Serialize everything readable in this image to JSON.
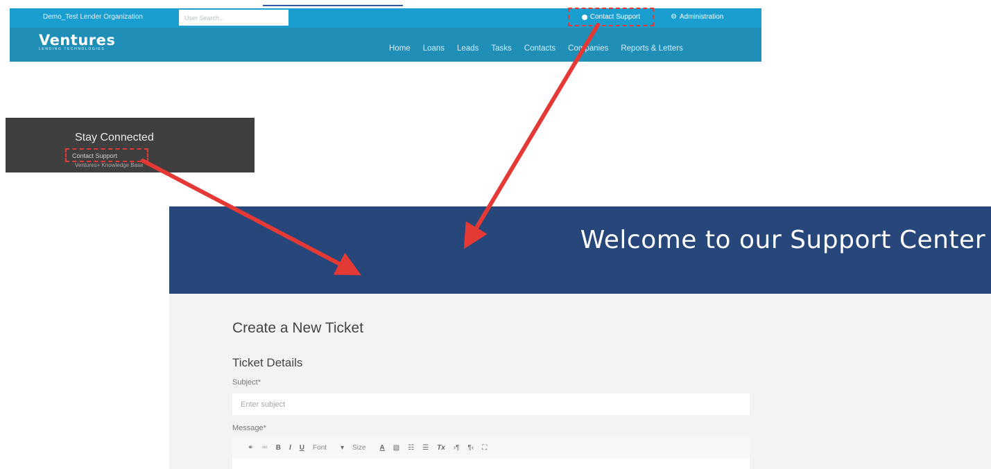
{
  "app_header": {
    "org_name": "Demo_Test Lender Organization",
    "search_placeholder": "User Search...",
    "contact_support": "Contact Support",
    "administration": "Administration",
    "logo_word": "Ventures",
    "logo_sub": "LENDING TECHNOLOGIES",
    "nav": [
      "Home",
      "Loans",
      "Leads",
      "Tasks",
      "Contacts",
      "Companies",
      "Reports & Letters"
    ]
  },
  "stay_connected": {
    "title": "Stay Connected",
    "contact_support": "Contact Support",
    "knowledge_base": "Ventures+ Knowledge Base"
  },
  "support_center": {
    "banner_title": "Welcome to our Support Center",
    "create_ticket": "Create a New Ticket",
    "ticket_details": "Ticket Details",
    "subject_label": "Subject*",
    "subject_placeholder": "Enter subject",
    "message_label": "Message*",
    "toolbar": {
      "link": "⚭",
      "unlink": "⚮",
      "bold": "B",
      "italic": "I",
      "underline": "U",
      "font": "Font",
      "size": "Size",
      "text_color": "A",
      "bg_color": "▧",
      "bulleted": "☷",
      "numbered": "☰",
      "clear": "Tx",
      "ltr": "›¶",
      "rtl": "¶‹",
      "fullscreen": "⛶"
    }
  },
  "colors": {
    "topbar": "#1a9dcf",
    "navbar": "#1f8fb8",
    "banner": "#27477a",
    "highlight": "#e53935",
    "arrow": "#e53935"
  },
  "icons": [
    "question-circle-icon",
    "gear-icon",
    "arrow-annotation"
  ]
}
